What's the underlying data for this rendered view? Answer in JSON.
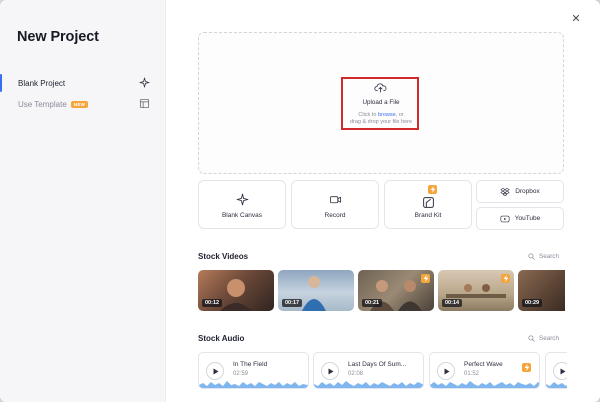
{
  "sidebar": {
    "title": "New Project",
    "items": [
      {
        "label": "Blank Project",
        "icon": "sparkle-icon",
        "active": true
      },
      {
        "label": "Use Template",
        "badge": "NEW",
        "icon": "template-icon",
        "active": false
      }
    ]
  },
  "upload": {
    "title": "Upload a File",
    "hint_prefix": "Click to ",
    "hint_link": "browse",
    "hint_suffix": ", or",
    "hint_line2": "drag & drop your file here"
  },
  "actions": {
    "blank_canvas": "Blank Canvas",
    "record": "Record",
    "brand_kit": "Brand Kit",
    "dropbox": "Dropbox",
    "youtube": "YouTube"
  },
  "stock_videos": {
    "title": "Stock Videos",
    "search_label": "Search",
    "items": [
      {
        "duration": "00:12",
        "premium": false
      },
      {
        "duration": "00:17",
        "premium": false
      },
      {
        "duration": "00:21",
        "premium": true
      },
      {
        "duration": "00:14",
        "premium": true
      },
      {
        "duration": "00:29",
        "premium": false
      }
    ]
  },
  "stock_audio": {
    "title": "Stock Audio",
    "search_label": "Search",
    "items": [
      {
        "name": "In The Field",
        "duration": "02:59",
        "premium": false
      },
      {
        "name": "Last Days Of Sum...",
        "duration": "02:08",
        "premium": false
      },
      {
        "name": "Perfect Wave",
        "duration": "01:52",
        "premium": true
      }
    ]
  },
  "colors": {
    "accent": "#3a6ef2",
    "premium": "#f4a53c",
    "highlight_box": "#d22a2a",
    "waveform": "#7fb6f0"
  }
}
